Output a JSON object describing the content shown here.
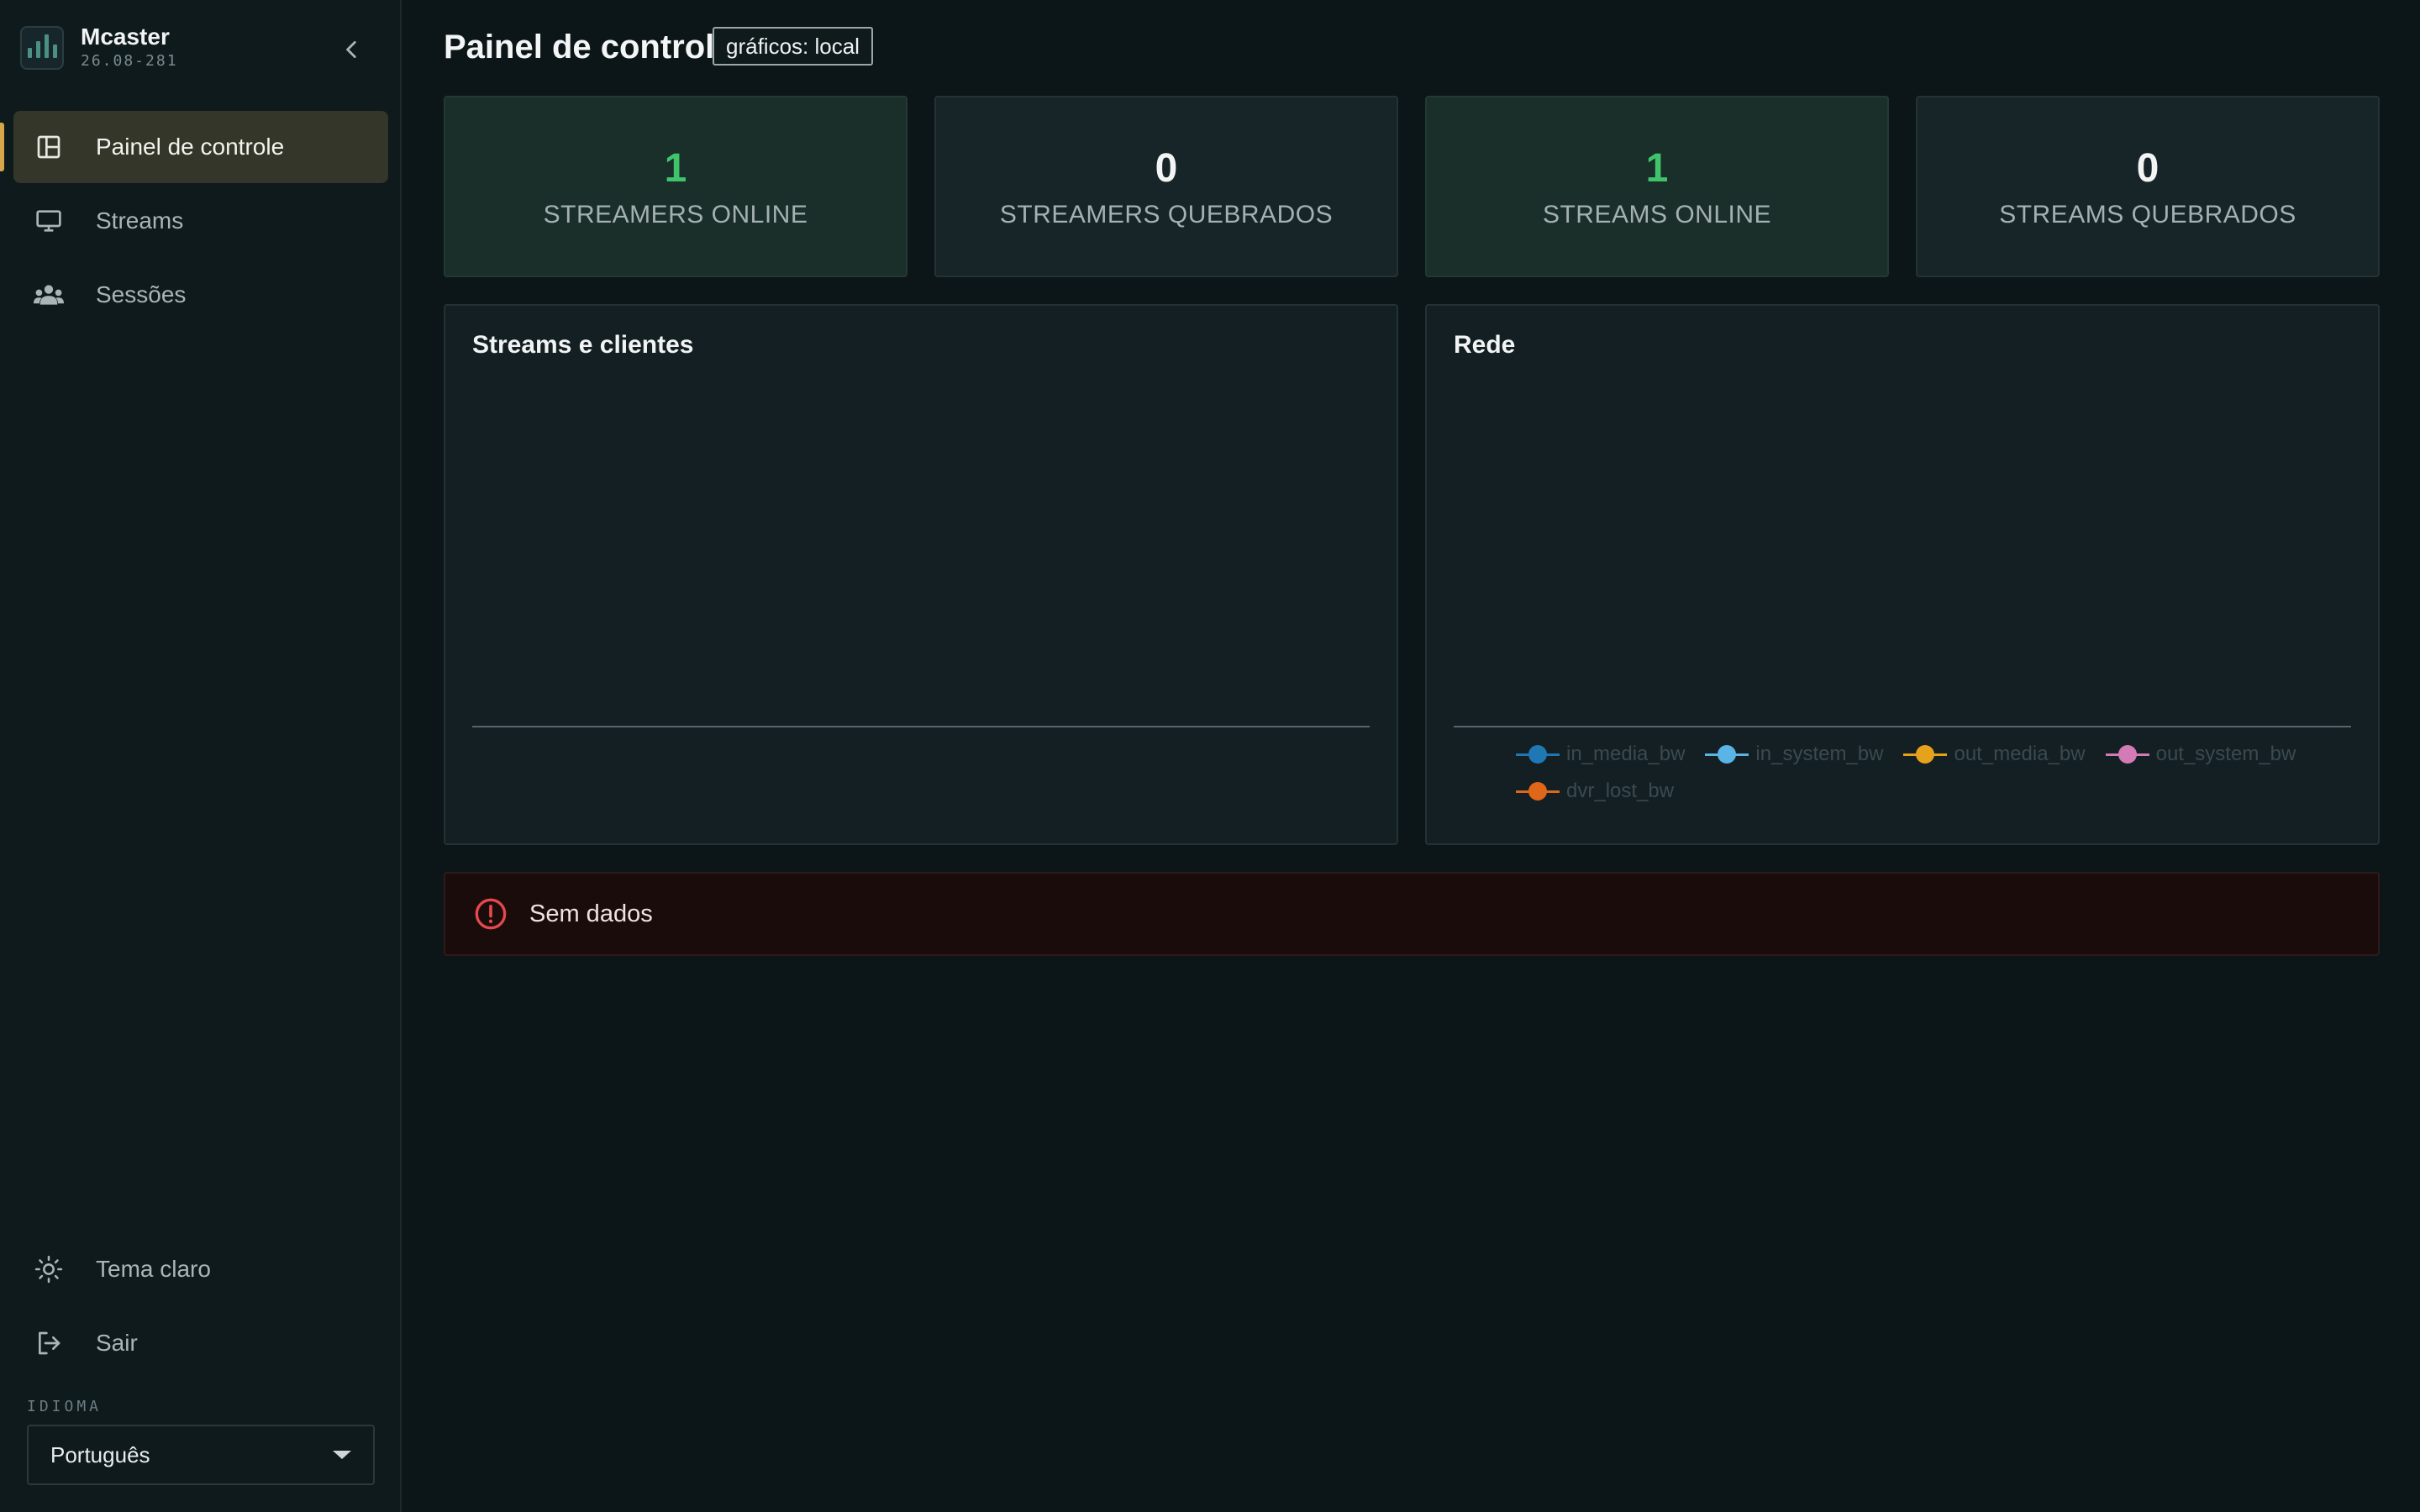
{
  "app": {
    "name": "Mcaster",
    "version": "26.08-281"
  },
  "sidebar": {
    "items": [
      {
        "label": "Painel de controle",
        "icon": "dashboard-icon",
        "active": true
      },
      {
        "label": "Streams",
        "icon": "monitor-icon",
        "active": false
      },
      {
        "label": "Sessões",
        "icon": "users-icon",
        "active": false
      }
    ],
    "bottom": [
      {
        "label": "Tema claro",
        "icon": "sun-icon"
      },
      {
        "label": "Sair",
        "icon": "logout-icon"
      }
    ],
    "language": {
      "label": "IDIOMA",
      "selected": "Português"
    }
  },
  "header": {
    "title": "Painel de controle",
    "badge": "gráficos: local"
  },
  "stats": [
    {
      "value": "1",
      "label": "STREAMERS ONLINE",
      "tone": "green"
    },
    {
      "value": "0",
      "label": "STREAMERS QUEBRADOS",
      "tone": "neutral"
    },
    {
      "value": "1",
      "label": "STREAMS ONLINE",
      "tone": "green"
    },
    {
      "value": "0",
      "label": "STREAMS QUEBRADOS",
      "tone": "neutral"
    }
  ],
  "panels": {
    "streams_clients": {
      "title": "Streams e clientes"
    },
    "network": {
      "title": "Rede",
      "legend": [
        {
          "name": "in_media_bw",
          "color": "#1f77b4"
        },
        {
          "name": "in_system_bw",
          "color": "#5ab4e6"
        },
        {
          "name": "out_media_bw",
          "color": "#e6a21a"
        },
        {
          "name": "out_system_bw",
          "color": "#d27bb4"
        },
        {
          "name": "dvr_lost_bw",
          "color": "#e0661a"
        }
      ]
    }
  },
  "alert": {
    "text": "Sem dados",
    "color": "#e5484d"
  },
  "colors": {
    "accent": "#d8a64a",
    "green": "#3fc46c",
    "background": "#0c1619"
  }
}
